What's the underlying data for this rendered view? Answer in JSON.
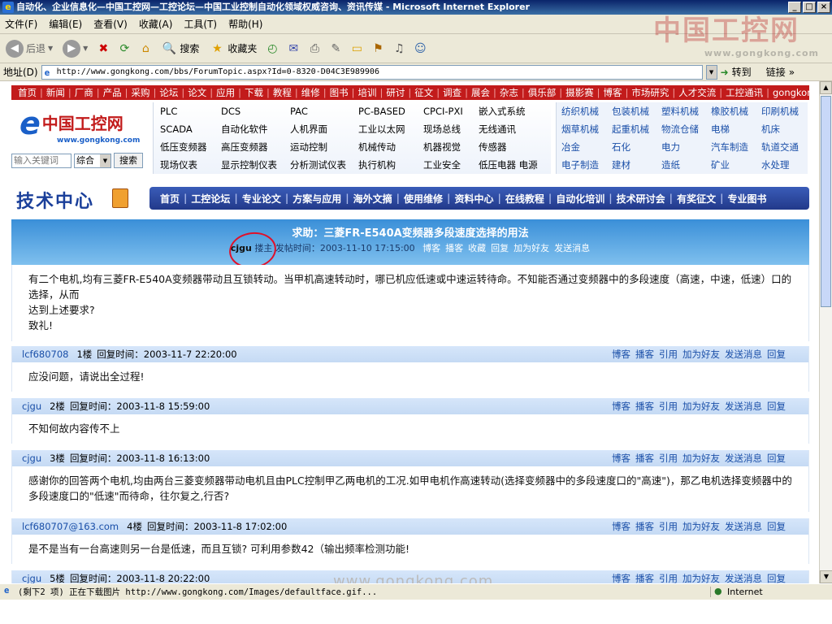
{
  "window": {
    "title": "自动化、企业信息化—中国工控网—工控论坛—中国工业控制自动化领域权威咨询、资讯传媒 - Microsoft Internet Explorer",
    "buttons": [
      "_",
      "□",
      "×"
    ]
  },
  "menu": [
    "文件(F)",
    "编辑(E)",
    "查看(V)",
    "收藏(A)",
    "工具(T)",
    "帮助(H)"
  ],
  "toolbar": {
    "back": "后退",
    "search": "搜索",
    "favorites": "收藏夹"
  },
  "address": {
    "label": "地址(D)",
    "url": "http://www.gongkong.com/bbs/ForumTopic.aspx?Id=0-8320-D04C3E989906",
    "go": "转到",
    "links": "链接"
  },
  "brand_overlay": {
    "name": "中国工控网",
    "site": "www.gongkong.com"
  },
  "topnav": [
    "首页",
    "新闻",
    "厂商",
    "产品",
    "采购",
    "论坛",
    "论文",
    "应用",
    "下载",
    "教程",
    "维修",
    "图书",
    "培训",
    "研讨",
    "征文",
    "调查",
    "展会",
    "杂志",
    "俱乐部",
    "摄影赛",
    "博客",
    "市场研究",
    "人才交流",
    "工控通讯",
    "gongkong TV"
  ],
  "logo": {
    "text": "中国工控网",
    "site": "www.gongkong.com"
  },
  "search": {
    "placeholder": "输入关键词",
    "option": "综合",
    "button": "搜索"
  },
  "categories": [
    "PLC",
    "DCS",
    "PAC",
    "PC-BASED",
    "CPCI-PXI",
    "嵌入式系统",
    "SCADA",
    "自动化软件",
    "人机界面",
    "工业以太网",
    "现场总线",
    "无线通讯",
    "低压变频器",
    "高压变频器",
    "运动控制",
    "机械传动",
    "机器视觉",
    "传感器",
    "现场仪表",
    "显示控制仪表",
    "分析测试仪表",
    "执行机构",
    "工业安全",
    "低压电器 电源"
  ],
  "industries": [
    "纺织机械",
    "包装机械",
    "塑料机械",
    "橡胶机械",
    "印刷机械",
    "烟草机械",
    "起重机械",
    "物流仓储",
    "电梯",
    "机床",
    "冶金",
    "石化",
    "电力",
    "汽车制造",
    "轨道交通",
    "电子制造",
    "建材",
    "造纸",
    "矿业",
    "水处理"
  ],
  "tech": {
    "title": "技术中心",
    "nav": [
      "首页",
      "工控论坛",
      "专业论文",
      "方案与应用",
      "海外文摘",
      "使用维修",
      "资料中心",
      "在线教程",
      "自动化培训",
      "技术研讨会",
      "有奖征文",
      "专业图书"
    ]
  },
  "topic": {
    "title": "求助：三菱FR-E540A变频器多段速度选择的用法",
    "author": "cjgu",
    "author_role": "搂主",
    "time": "发帖时间：2003-11-10 17:15:00",
    "actions": [
      "博客",
      "播客",
      "收藏",
      "回复",
      "加为好友",
      "发送消息"
    ],
    "body": "有二个电机,均有三菱FR-E540A变频器带动且互锁转动。当甲机高速转动时，哪已机应低速或中速运转待命。不知能否通过变频器中的多段速度（高速，中速，低速）口的选择，从而\n达到上述要求?\n致礼!"
  },
  "posts": [
    {
      "user": "lcf680708",
      "floor": "1楼",
      "time": "回复时间：2003-11-7 22:20:00",
      "body": "应没问题，请说出全过程!"
    },
    {
      "user": "cjgu",
      "floor": "2楼",
      "time": "回复时间：2003-11-8 15:59:00",
      "body": "不知何故内容传不上"
    },
    {
      "user": "cjgu",
      "floor": "3楼",
      "time": "回复时间：2003-11-8 16:13:00",
      "body": "感谢你的回答两个电机,均由两台三菱变频器带动电机且由PLC控制甲乙两电机的工况.如甲电机作高速转动(选择变频器中的多段速度口的\"高速\")，那乙电机选择变频器中的多段速度口的\"低速\"而待命，往尔复之,行否?"
    },
    {
      "user": "lcf680707@163.com",
      "floor": "4楼",
      "time": "回复时间：2003-11-8 17:02:00",
      "body": "是不是当有一台高速则另一台是低速，而且互锁? 可利用参数42（输出频率检测功能!"
    },
    {
      "user": "cjgu",
      "floor": "5楼",
      "time": "回复时间：2003-11-8 20:22:00",
      "body": ""
    }
  ],
  "post_actions": [
    "博客",
    "播客",
    "引用",
    "加为好友",
    "发送消息",
    "回复"
  ],
  "status": {
    "message": "(剩下2 项) 正在下载图片 http://www.gongkong.com/Images/defaultface.gif...",
    "zone": "Internet"
  },
  "watermark": "www.gongkong.com"
}
